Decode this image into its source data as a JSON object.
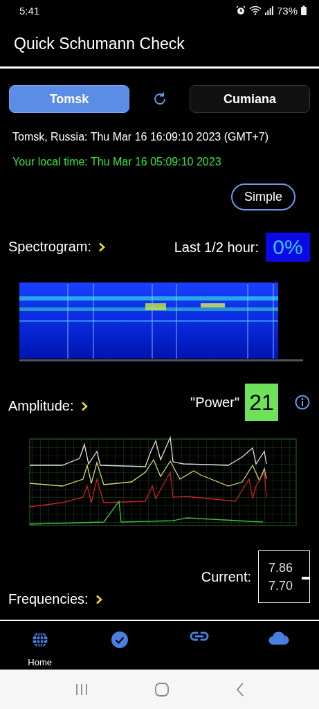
{
  "status_bar": {
    "time": "5:41",
    "battery": "73%"
  },
  "app_bar": {
    "title": "Quick Schumann Check"
  },
  "stations": [
    {
      "label": "Tomsk",
      "selected": true
    },
    {
      "label": "Cumiana",
      "selected": false
    }
  ],
  "station_time": "Tomsk, Russia: Thu Mar 16 16:09:10 2023 (GMT+7)",
  "local_time": "Your local time: Thu Mar 16 05:09:10 2023",
  "mode_button": "Simple",
  "spectrogram": {
    "label": "Spectrogram:",
    "reading_label": "Last 1/2 hour:",
    "reading": "0%"
  },
  "amplitude": {
    "label": "Amplitude:",
    "reading_label": "\"Power\"",
    "reading": "21"
  },
  "frequencies": {
    "label": "Frequencies:",
    "reading_label": "Current:",
    "values": [
      "7.86",
      "7.70"
    ]
  },
  "bottom_nav": [
    {
      "kind": "globe",
      "label": "Home"
    },
    {
      "kind": "check"
    },
    {
      "kind": "link"
    },
    {
      "kind": "cloud"
    }
  ]
}
